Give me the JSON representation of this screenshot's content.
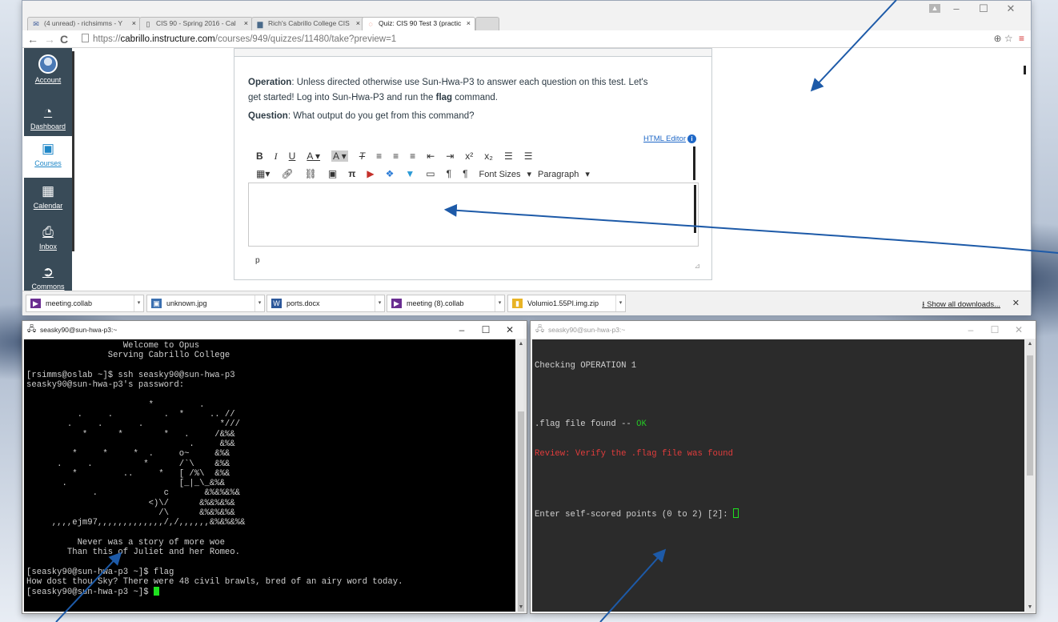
{
  "browser": {
    "tabs": [
      {
        "label": "(4 unread) - richsimms - Y",
        "icon": "mail-icon",
        "active": false
      },
      {
        "label": "CIS 90 - Spring 2016 - Cal",
        "icon": "page-icon",
        "active": false
      },
      {
        "label": "Rich's Cabrillo College CIS",
        "icon": "image-icon",
        "active": false
      },
      {
        "label": "Quiz: CIS 90 Test 3 (practic",
        "icon": "quiz-icon",
        "active": true
      }
    ],
    "url_scheme": "https://",
    "url_host": "cabrillo.instructure.com",
    "url_path": "/courses/949/quizzes/11480/take?preview=1"
  },
  "canvas_nav": [
    {
      "label": "Account",
      "icon": "avatar-icon"
    },
    {
      "label": "Dashboard",
      "icon": "dashboard-icon"
    },
    {
      "label": "Courses",
      "icon": "courses-icon",
      "active": true
    },
    {
      "label": "Calendar",
      "icon": "calendar-icon"
    },
    {
      "label": "Inbox",
      "icon": "inbox-icon"
    },
    {
      "label": "Commons",
      "icon": "commons-icon"
    }
  ],
  "quiz": {
    "operation_label": "Operation",
    "operation_text_1": ": Unless directed otherwise use Sun-Hwa-P3 to answer each question on this test. Let's",
    "operation_text_2": "get started! Log into Sun-Hwa-P3 and run the ",
    "operation_cmd": "flag",
    "operation_text_3": " command.",
    "question_label": "Question",
    "question_text": ": What output do you get from this command?",
    "html_editor_link": "HTML Editor",
    "font_sizes_label": "Font Sizes",
    "paragraph_label": "Paragraph",
    "status_path": "p"
  },
  "downloads": {
    "items": [
      {
        "name": "meeting.collab",
        "icon": "collab-icon",
        "color": "#6a2d91"
      },
      {
        "name": "unknown.jpg",
        "icon": "image-file-icon",
        "color": "#3a6fb0"
      },
      {
        "name": "ports.docx",
        "icon": "word-icon",
        "color": "#2b579a"
      },
      {
        "name": "meeting (8).collab",
        "icon": "collab-icon",
        "color": "#6a2d91"
      },
      {
        "name": "Volumio1.55PI.img.zip",
        "icon": "zip-icon",
        "color": "#e8b325"
      }
    ],
    "show_all": "Show all downloads..."
  },
  "terminal_left": {
    "title": "seasky90@sun-hwa-p3:~",
    "lines": [
      "                   Welcome to Opus",
      "                Serving Cabrillo College",
      "",
      "[rsimms@oslab ~]$ ssh seasky90@sun-hwa-p3",
      "seasky90@sun-hwa-p3's password:",
      "",
      "                        *         .",
      "          .     .          .  *     .. //",
      "        .     .       .               *///",
      "           *      *        *   .     /&%&",
      "                                .     &%&",
      "         *     *     *  .     o~     &%&",
      "      .     .          *      /`\\    &%&",
      "         *         ..     *   [ /%\\  &%&",
      "       .                      [_|_\\_&%&",
      "             .             c       &%&%&%&",
      "                        <)\\/      &%&%&%&",
      "                          /\\      &%&%&%&",
      "     ,,,,ejm97,,,,,,,,,,,,,/,/,,,,,,&%&%&%&",
      "",
      "          Never was a story of more woe",
      "        Than this of Juliet and her Romeo.",
      "",
      "[seasky90@sun-hwa-p3 ~]$ flag",
      "How dost thou Sky? There were 48 civil brawls, bred of an airy word today.",
      "[seasky90@sun-hwa-p3 ~]$ "
    ]
  },
  "terminal_right": {
    "title": "seasky90@sun-hwa-p3:~",
    "line1": "Checking OPERATION 1",
    "line2_a": ".flag file found -- ",
    "line2_b": "OK",
    "line3_a": "Review:",
    "line3_b": " Verify the .flag file was found",
    "line4": "Enter self-scored points (0 to 2) [2]: "
  },
  "colors": {
    "canvas_nav_bg": "#394b58",
    "accent_blue": "#1f87c7",
    "ok_green": "#25c425",
    "review_red": "#e03c3c",
    "arrow_blue": "#1d5aa8"
  }
}
